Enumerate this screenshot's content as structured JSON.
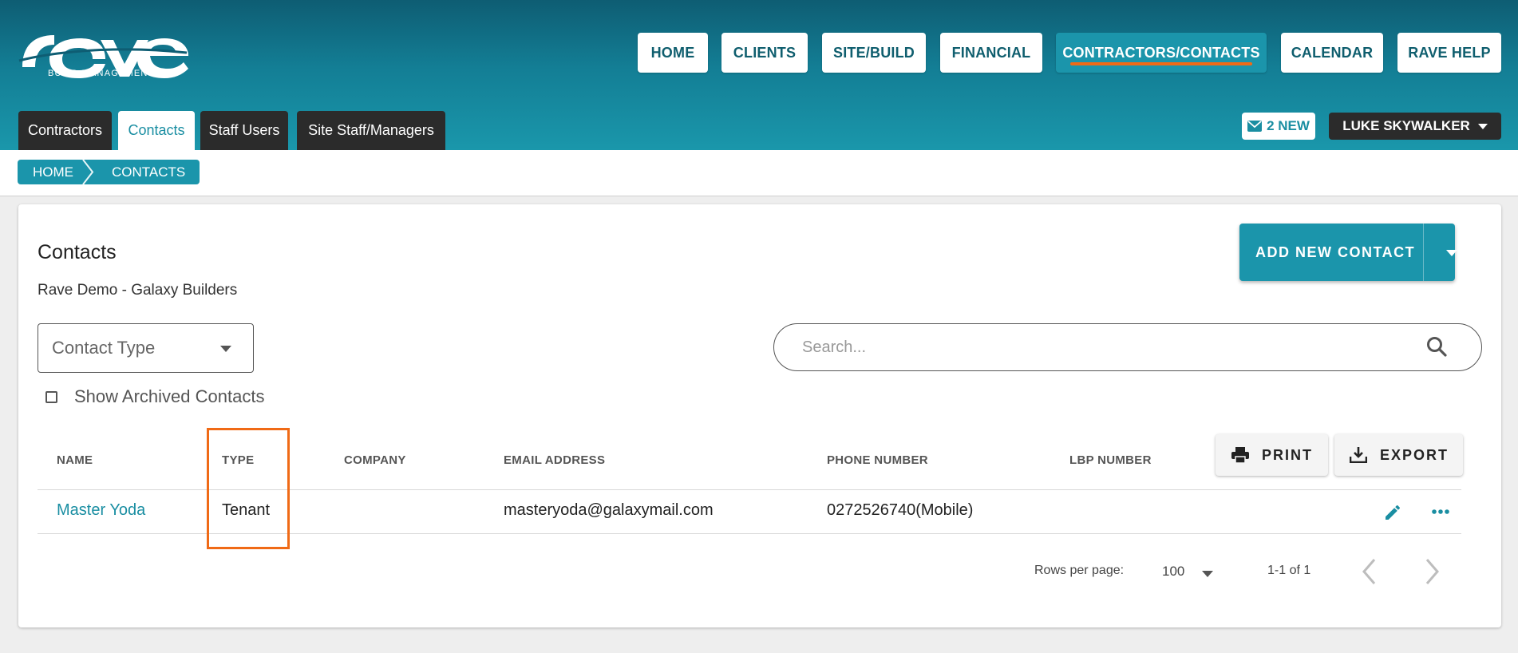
{
  "brand": {
    "logo_text": "rave",
    "tagline": "BUILD MANAGEMENT"
  },
  "colors": {
    "primary": "#1b95ab",
    "accent": "#f06a16",
    "dark": "#2b2b2b",
    "header_top": "#0e5d73"
  },
  "topnav": {
    "items": [
      {
        "label": "HOME"
      },
      {
        "label": "CLIENTS"
      },
      {
        "label": "SITE/BUILD"
      },
      {
        "label": "FINANCIAL"
      },
      {
        "label": "CONTRACTORS/CONTACTS",
        "active": true
      },
      {
        "label": "CALENDAR"
      },
      {
        "label": "RAVE HELP"
      }
    ]
  },
  "subtabs": {
    "items": [
      {
        "label": "Contractors"
      },
      {
        "label": "Contacts",
        "active": true
      },
      {
        "label": "Staff Users"
      },
      {
        "label": "Site Staff/Managers"
      }
    ]
  },
  "header": {
    "messages_label": "2 NEW",
    "user_name": "LUKE SKYWALKER"
  },
  "breadcrumb": {
    "items": [
      "HOME",
      "CONTACTS"
    ]
  },
  "page": {
    "title": "Contacts",
    "subtitle": "Rave Demo - Galaxy Builders",
    "add_button": "ADD NEW CONTACT",
    "contact_type_placeholder": "Contact Type",
    "search_placeholder": "Search...",
    "show_archived_label": "Show Archived Contacts",
    "print_label": "PRINT",
    "export_label": "EXPORT"
  },
  "table": {
    "columns": [
      "NAME",
      "TYPE",
      "COMPANY",
      "EMAIL ADDRESS",
      "PHONE NUMBER",
      "LBP NUMBER"
    ],
    "rows": [
      {
        "name": "Master Yoda",
        "type": "Tenant",
        "company": "",
        "email": "masteryoda@galaxymail.com",
        "phone": "0272526740(Mobile)",
        "lbp": ""
      }
    ]
  },
  "pagination": {
    "rows_per_page_label": "Rows per page:",
    "rows_per_page": "100",
    "range": "1-1 of 1"
  }
}
